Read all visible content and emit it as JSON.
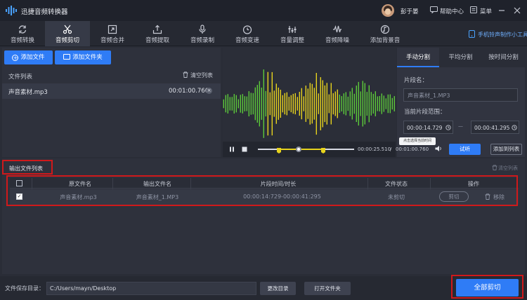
{
  "app": {
    "title": "迅捷音频转换器"
  },
  "titlebar": {
    "username": "彭于晏",
    "help_label": "帮助中心",
    "menu_label": "菜单"
  },
  "toolbar": {
    "tabs": [
      {
        "label": "音频转换",
        "icon": "refresh-icon"
      },
      {
        "label": "音频剪切",
        "icon": "scissors-icon"
      },
      {
        "label": "音频合并",
        "icon": "merge-icon"
      },
      {
        "label": "音频提取",
        "icon": "extract-icon"
      },
      {
        "label": "音频录制",
        "icon": "microphone-icon"
      },
      {
        "label": "音频变速",
        "icon": "speedometer-icon"
      },
      {
        "label": "音量调整",
        "icon": "volume-icon"
      },
      {
        "label": "音频降噪",
        "icon": "waveform-icon"
      },
      {
        "label": "添加背景音",
        "icon": "music-note-icon"
      }
    ],
    "active_tab": "音频剪切",
    "promo_label": "手机铃声制作小工具"
  },
  "file_panel": {
    "add_file_label": "添加文件",
    "add_folder_label": "添加文件夹",
    "list_title": "文件列表",
    "clear_list_label": "清空列表",
    "files": [
      {
        "name": "声音素材.mp3",
        "duration": "00:01:00.760"
      }
    ]
  },
  "player": {
    "current_time": "00:00:25.510",
    "separator": "/",
    "total_time": "00:01:00.760"
  },
  "split_panel": {
    "tabs": [
      "手动分割",
      "平均分割",
      "按时间分割"
    ],
    "active_tab": "手动分割",
    "segment_name_label": "片段名：",
    "segment_name_value": "声音素材_1.MP3",
    "range_label": "当前片段范围：",
    "start_time": "00:00:14.729",
    "end_time": "00:00:41.295",
    "range_dash": "—",
    "tooltip": "点击选择当前时间",
    "preview_label": "试听",
    "add_to_list_label": "添加到列表"
  },
  "output_panel": {
    "title": "输出文件列表",
    "clear_label": "清空列表",
    "columns": [
      "原文件名",
      "输出文件名",
      "片段时间/时长",
      "文件状态",
      "操作"
    ],
    "rows": [
      {
        "source": "声音素材.mp3",
        "output": "声音素材_1.MP3",
        "range": "00:00:14:729-00:00:41:295",
        "status": "未剪切",
        "cut_label": "剪切",
        "remove_label": "移除"
      }
    ]
  },
  "footer": {
    "save_dir_label": "文件保存目录：",
    "save_dir_value": "C:/Users/mayn/Desktop",
    "change_dir_label": "更改目录",
    "open_folder_label": "打开文件夹",
    "cut_all_label": "全部剪切"
  },
  "colors": {
    "accent": "#2f7cf6",
    "highlight": "#d0191b",
    "waveform_green": "#5cc93a",
    "waveform_yellow": "#e6d21d"
  }
}
